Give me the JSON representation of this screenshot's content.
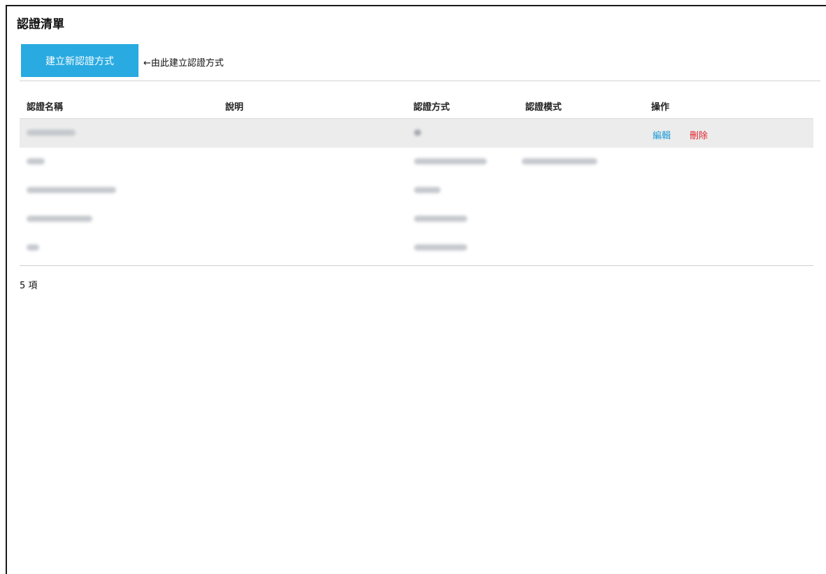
{
  "page": {
    "title": "認證清單"
  },
  "toolbar": {
    "create_label": "建立新認證方式",
    "hint": "←由此建立認證方式"
  },
  "table": {
    "headers": [
      "認證名稱",
      "說明",
      "認證方式",
      "認證模式",
      "操作"
    ],
    "row_actions": {
      "edit": "編輯",
      "delete": "刪除"
    },
    "rows_note": "cell contents are blurred in the screenshot",
    "row_count": 5
  },
  "footer": {
    "count_text": "5 項"
  },
  "colors": {
    "accent": "#29aae1",
    "edit": "#1e9bd7",
    "delete": "#e0222a",
    "highlight_row": "#ececec"
  }
}
